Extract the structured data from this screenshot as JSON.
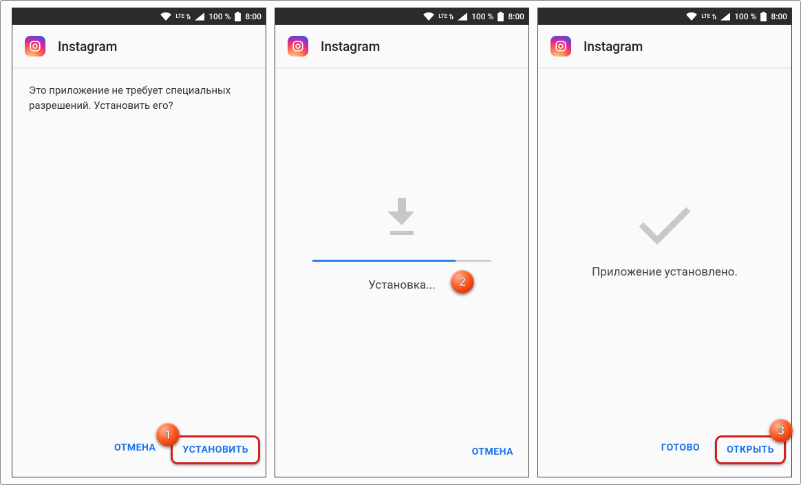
{
  "status": {
    "lte_label": "LTE",
    "battery_text": "100 %",
    "time": "8:00"
  },
  "app": {
    "name": "Instagram"
  },
  "panel1": {
    "message": "Это приложение не требует специальных разрешений. Установить его?",
    "cancel": "ОТМЕНА",
    "install": "УСТАНОВИТЬ",
    "badge": "1"
  },
  "panel2": {
    "progress_label": "Установка...",
    "progress_percent": 80,
    "cancel": "ОТМЕНА",
    "badge": "2"
  },
  "panel3": {
    "done_label": "Приложение установлено.",
    "done_btn": "ГОТОВО",
    "open_btn": "ОТКРЫТЬ",
    "badge": "3"
  }
}
